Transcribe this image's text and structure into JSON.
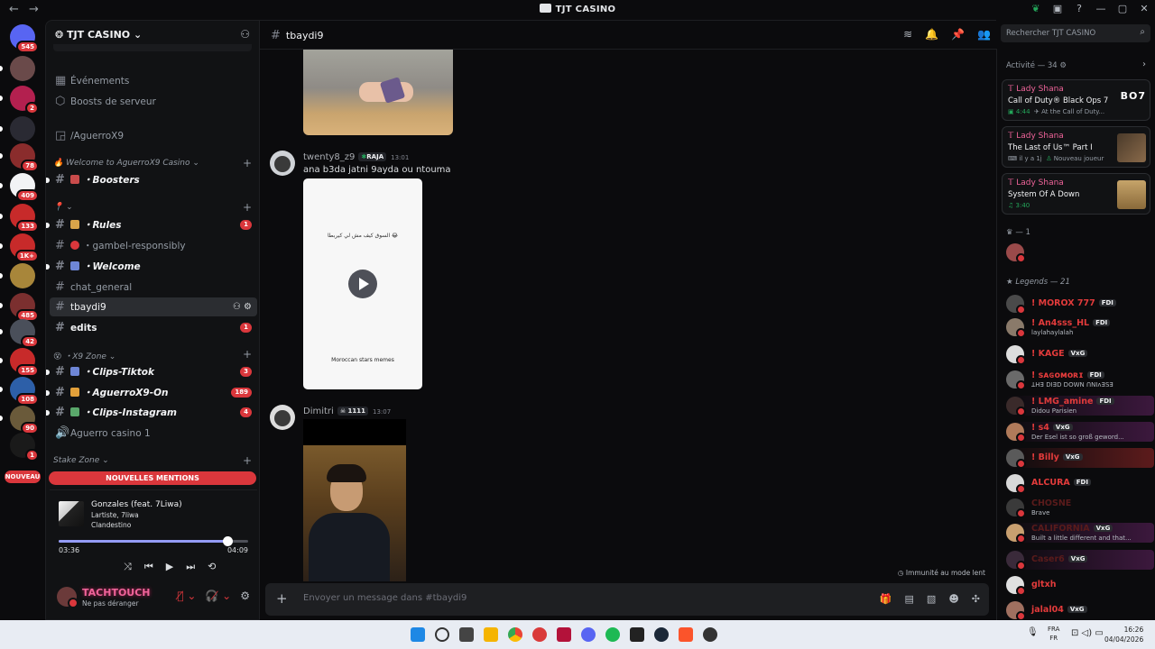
{
  "window": {
    "title": "TJT CASINO",
    "back": "←",
    "forward": "→"
  },
  "rail": {
    "servers": [
      {
        "badge": "545",
        "color": "#5865f2"
      },
      {
        "badge": "",
        "color": "#6a4a4a"
      },
      {
        "badge": "2",
        "color": "#b3204f"
      },
      {
        "badge": "",
        "color": "#2a2a33"
      },
      {
        "badge": "78",
        "color": "#8a2c2c"
      },
      {
        "badge": "409",
        "color": "#f2f3f5"
      },
      {
        "badge": "133",
        "color": "#c72a2a"
      },
      {
        "badge": "1K+",
        "color": "#c72a2a"
      },
      {
        "badge": "",
        "color": "#a8863a"
      },
      {
        "badge": "485",
        "color": "#7b2f2f"
      },
      {
        "badge": "42",
        "color": "#4a4f5a"
      },
      {
        "badge": "155",
        "color": "#c72a2a"
      },
      {
        "badge": "108",
        "color": "#2d5fa8"
      },
      {
        "badge": "90",
        "color": "#6a5a3a"
      },
      {
        "badge": "1",
        "color": "#1a1a1a"
      }
    ],
    "nouveau": "NOUVEAU"
  },
  "guild": {
    "name": "TJT CASINO",
    "items": [
      {
        "label": "Événements"
      },
      {
        "label": "Boosts de serveur"
      },
      {
        "label": "/AguerroX9"
      }
    ],
    "categories": [
      {
        "label": "Welcome to AguerroX9 Casino"
      },
      {
        "label": ""
      },
      {
        "label": "X9 Zone"
      },
      {
        "label": "Stake Zone"
      }
    ],
    "channels": [
      {
        "label": "Boosters",
        "count": ""
      },
      {
        "label": "Rules",
        "count": "1"
      },
      {
        "label": "gambel-responsibly",
        "count": ""
      },
      {
        "label": "Welcome",
        "count": ""
      },
      {
        "label": "chat_general",
        "count": ""
      },
      {
        "label": "tbaydi9",
        "count": ""
      },
      {
        "label": "edits",
        "count": "1"
      },
      {
        "label": "Clips-Tiktok",
        "count": "3"
      },
      {
        "label": "AguerroX9-On",
        "count": "189"
      },
      {
        "label": "Clips-Instagram",
        "count": "4"
      },
      {
        "label": "Aguerro casino 1",
        "count": ""
      }
    ],
    "mention_bar": "NOUVELLES MENTIONS"
  },
  "music": {
    "song": "Gonzales (feat. 7Liwa)",
    "artist": "Lartiste, 7liwa",
    "album": "Clandestino",
    "elapsed": "03:36",
    "total": "04:09",
    "progress": 0.89
  },
  "user": {
    "name": "TACHTOUCH",
    "status": "Ne pas déranger"
  },
  "channel": {
    "name": "tbaydi9",
    "placeholder": "Envoyer un message dans #tbaydi9",
    "slowmode": "Immunité au mode lent"
  },
  "messages": [
    {
      "author": "twenty8_z9",
      "tag": "RAJA",
      "time": "13:01",
      "text": "ana b3da jatni 9ayda ou ntouma",
      "video_caption_top": "السوق كيف مش لي كيربطا 😂",
      "video_caption_bottom": "Moroccan stars memes"
    },
    {
      "author": "Dimitri",
      "tag": "1111",
      "time": "13:07"
    }
  ],
  "search": {
    "placeholder": "Rechercher TJT CASINO"
  },
  "members": {
    "activity_label": "Activité — 34",
    "activities": [
      {
        "name": "Lady Shana",
        "game": "Call of Duty® Black Ops 7",
        "time": "4:44",
        "detail": "At the Call of Duty...",
        "thumb": "BO7"
      },
      {
        "name": "Lady Shana",
        "game": "The Last of Us™ Part I",
        "time": "il y a 1j",
        "detail": "Nouveau joueur",
        "thumb": ""
      },
      {
        "name": "Lady Shana",
        "game": "System Of A Down",
        "time": "3:40",
        "detail": "",
        "thumb": ""
      }
    ],
    "group1": "— 1",
    "legends_label": "Legends — 21",
    "list": [
      {
        "name": "! MOROX 777",
        "tag": "FDI",
        "sub": "",
        "color": "#e23b3b"
      },
      {
        "name": "! An4sss_HL",
        "tag": "FDI",
        "sub": "laylahaylalah",
        "color": "#e23b3b"
      },
      {
        "name": "! KAGE",
        "tag": "VxG",
        "sub": "",
        "color": "#e23b3b"
      },
      {
        "name": "! ꜱᴀɢᴏᴍᴏʀɪ",
        "tag": "FDI",
        "sub": "ꓕHƎ DIƎꓓ DOWN ꓵNIʌƎSƎ",
        "color": "#e23b3b"
      },
      {
        "name": "! LMG_amine",
        "tag": "FDI",
        "sub": "Didou Parisien",
        "color": "#e23b3b"
      },
      {
        "name": "! s4",
        "tag": "VxG",
        "sub": "Der Esel ist so groß geword...",
        "color": "#e23b3b"
      },
      {
        "name": "! Billy",
        "tag": "VxG",
        "sub": "",
        "color": "#e23b3b"
      },
      {
        "name": "ALCURA",
        "tag": "FDI",
        "sub": "",
        "color": "#e23b3b"
      },
      {
        "name": "CHOSNE",
        "tag": "",
        "sub": "Brave",
        "color": "#5a1b1b"
      },
      {
        "name": "CALIFORNIA",
        "tag": "VxG",
        "sub": "Built a little different and that...",
        "color": "#5a1b1b"
      },
      {
        "name": "Caser6",
        "tag": "VxG",
        "sub": "",
        "color": "#5a1b1b"
      },
      {
        "name": "gltxh",
        "tag": "",
        "sub": "",
        "color": "#e23b3b"
      },
      {
        "name": "jalal04",
        "tag": "VxG",
        "sub": "",
        "color": "#e23b3b"
      }
    ]
  },
  "taskbar": {
    "lang_top": "FRA",
    "lang_bottom": "FR",
    "time": "16:26",
    "date": "04/04/2026"
  }
}
